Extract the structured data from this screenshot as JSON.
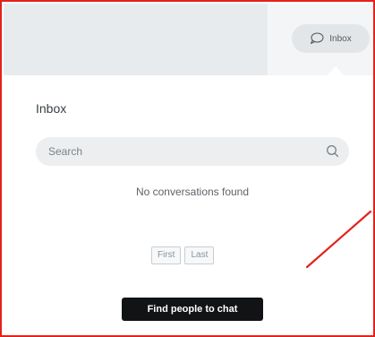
{
  "header": {
    "inbox_label": "Inbox",
    "inbox_icon": "speech-bubble-icon"
  },
  "panel": {
    "title": "Inbox",
    "search": {
      "placeholder": "Search",
      "value": "",
      "icon": "search-icon"
    },
    "empty_message": "No conversations found",
    "pagination": {
      "first_label": "First",
      "last_label": "Last"
    },
    "cta_label": "Find people to chat"
  },
  "colors": {
    "annotation_red": "#e2231a",
    "cta_background": "#111315",
    "header_background": "#e8ebed"
  }
}
